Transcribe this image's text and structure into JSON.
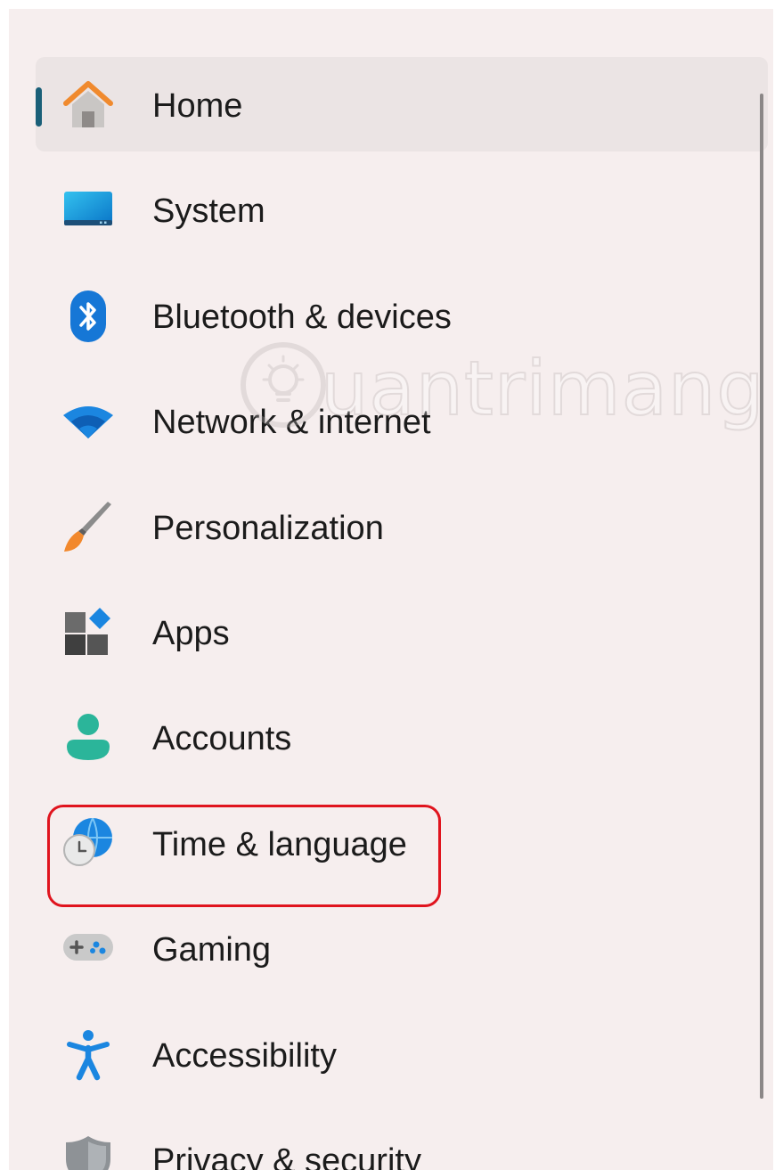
{
  "nav": {
    "items": [
      {
        "label": "Home",
        "icon": "home-icon",
        "selected": true
      },
      {
        "label": "System",
        "icon": "system-icon"
      },
      {
        "label": "Bluetooth & devices",
        "icon": "bluetooth-icon"
      },
      {
        "label": "Network & internet",
        "icon": "wifi-icon"
      },
      {
        "label": "Personalization",
        "icon": "paintbrush-icon"
      },
      {
        "label": "Apps",
        "icon": "apps-icon"
      },
      {
        "label": "Accounts",
        "icon": "account-icon"
      },
      {
        "label": "Time & language",
        "icon": "globe-clock-icon",
        "highlighted": true
      },
      {
        "label": "Gaming",
        "icon": "gamepad-icon"
      },
      {
        "label": "Accessibility",
        "icon": "accessibility-icon"
      },
      {
        "label": "Privacy & security",
        "icon": "shield-icon"
      }
    ]
  },
  "watermark": {
    "text": "uantrimang"
  },
  "colors": {
    "panel_background": "#f6eeee",
    "selected_background": "#ebe4e4",
    "selection_indicator": "#1a5f78",
    "highlight_border": "#e0141e",
    "text": "#1b1b1b"
  }
}
